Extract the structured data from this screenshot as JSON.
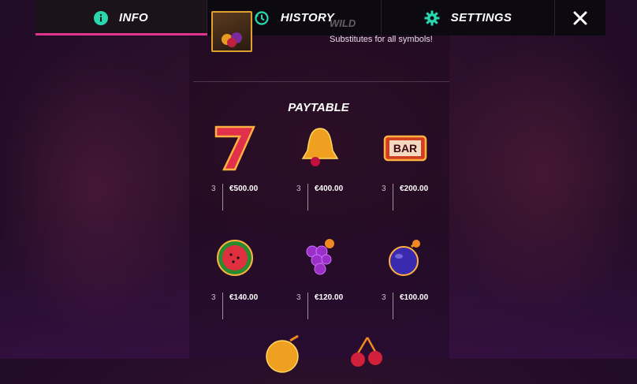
{
  "nav": {
    "tabs": [
      {
        "label": "INFO",
        "icon": "info-icon"
      },
      {
        "label": "HISTORY",
        "icon": "history-icon"
      },
      {
        "label": "SETTINGS",
        "icon": "gear-icon"
      }
    ],
    "close_icon": "close-icon"
  },
  "colors": {
    "accent": "#e0348e",
    "icon": "#28d9b0"
  },
  "wild": {
    "title": "WILD",
    "description": "Substitutes for all symbols!"
  },
  "paytable": {
    "title": "PAYTABLE",
    "rows": [
      [
        {
          "symbol": "seven",
          "count": "3",
          "amount": "€500.00"
        },
        {
          "symbol": "bell",
          "count": "3",
          "amount": "€400.00"
        },
        {
          "symbol": "bar",
          "count": "3",
          "amount": "€200.00",
          "symbol_text": "BAR"
        }
      ],
      [
        {
          "symbol": "watermelon",
          "count": "3",
          "amount": "€140.00"
        },
        {
          "symbol": "grapes",
          "count": "3",
          "amount": "€120.00"
        },
        {
          "symbol": "plum",
          "count": "3",
          "amount": "€100.00"
        }
      ],
      [
        {
          "symbol": "orange"
        },
        {
          "symbol": "cherries"
        }
      ]
    ]
  }
}
